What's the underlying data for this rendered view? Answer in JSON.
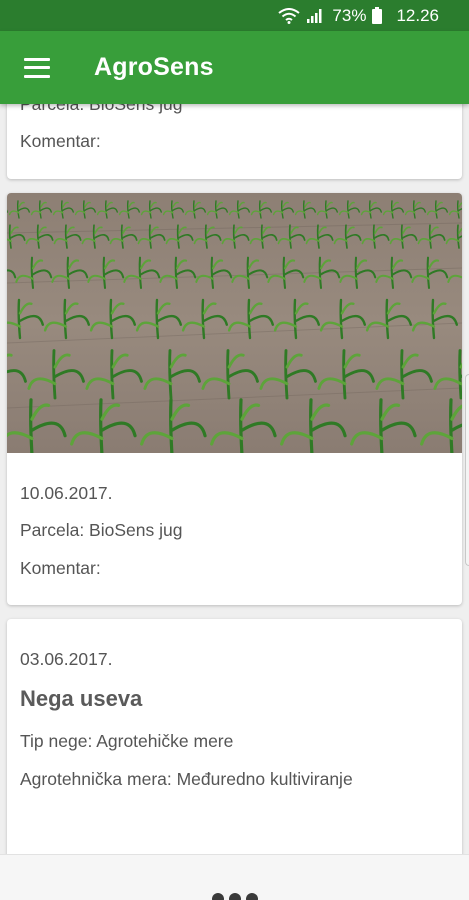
{
  "status_bar": {
    "battery_percent": "73%",
    "time": "12.26",
    "icons": [
      "wifi-icon",
      "signal-icon",
      "battery-icon"
    ]
  },
  "app_bar": {
    "title": "AgroSens",
    "menu_icon": "hamburger-menu-icon"
  },
  "colors": {
    "status_bar": "#2b7d2e",
    "app_bar": "#389e3a",
    "text": "#555555"
  },
  "feed": [
    {
      "parcel": "Parcela: BioSens jug",
      "comment": "Komentar:"
    },
    {
      "image": "corn-field-photo",
      "date": "10.06.2017.",
      "parcel": "Parcela: BioSens jug",
      "comment": "Komentar:"
    },
    {
      "date": "03.06.2017.",
      "heading": "Nega useva",
      "care_type": "Tip nege: Agrotehičke mere",
      "measure": "Agrotehnička mera: Međuredno kultiviranje"
    }
  ],
  "bottom_bar": {
    "more_icon": "more-dots-icon"
  }
}
